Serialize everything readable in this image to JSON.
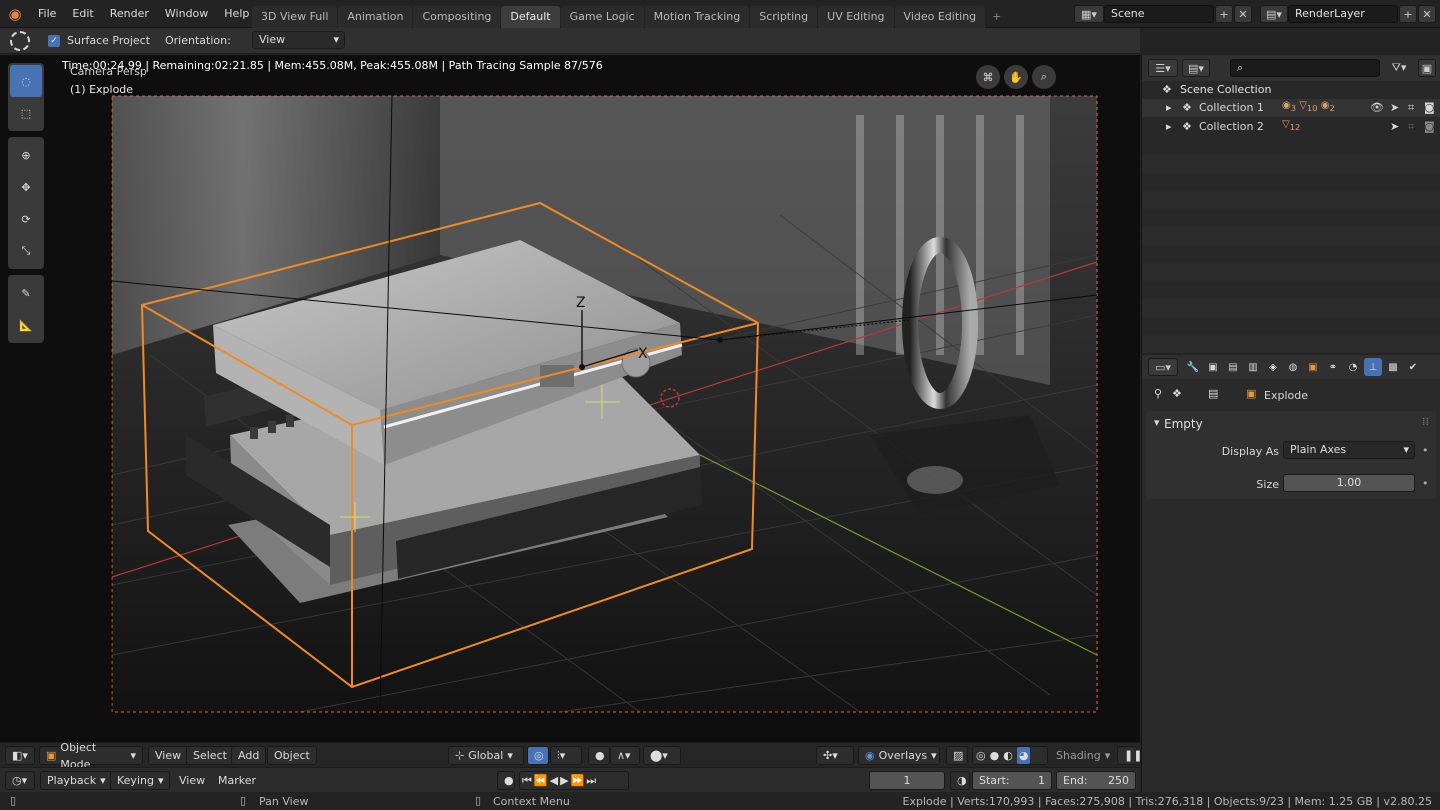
{
  "menus": [
    "File",
    "Edit",
    "Render",
    "Window",
    "Help"
  ],
  "workspace_tabs": [
    {
      "label": "3D View Full",
      "active": false
    },
    {
      "label": "Animation",
      "active": false
    },
    {
      "label": "Compositing",
      "active": false
    },
    {
      "label": "Default",
      "active": true
    },
    {
      "label": "Game Logic",
      "active": false
    },
    {
      "label": "Motion Tracking",
      "active": false
    },
    {
      "label": "Scripting",
      "active": false
    },
    {
      "label": "UV Editing",
      "active": false
    },
    {
      "label": "Video Editing",
      "active": false
    }
  ],
  "scene": {
    "name": "Scene",
    "render_layer": "RenderLayer"
  },
  "tool_settings": {
    "surface_project_label": "Surface Project",
    "surface_project_checked": true,
    "orientation_label": "Orientation:",
    "orientation_value": "View"
  },
  "viewport": {
    "render_stats": "Time:00:24.99 | Remaining:02:21.85 | Mem:455.08M, Peak:455.08M | Path Tracing Sample 87/576",
    "view_name": "Camera Persp",
    "object_label": "(1) Explode",
    "gizmo_x": "X",
    "gizmo_z": "Z"
  },
  "viewport_header": {
    "mode": "Object Mode",
    "view": "View",
    "select": "Select",
    "add": "Add",
    "object": "Object",
    "transform_orientation": "Global",
    "overlays": "Overlays",
    "shading": "Shading"
  },
  "timeline": {
    "playback": "Playback",
    "keying": "Keying",
    "view": "View",
    "marker": "Marker",
    "current_frame": "1",
    "start_label": "Start:",
    "start": "1",
    "end_label": "End:",
    "end": "250"
  },
  "statusbar": {
    "pan": "Pan View",
    "context": "Context Menu",
    "stats": "Explode | Verts:170,993 | Faces:275,908 | Tris:276,318 | Objects:9/23 | Mem: 1.25 GB | v2.80.25"
  },
  "outliner": {
    "root": "Scene Collection",
    "collections": [
      {
        "name": "Collection 1",
        "badges": [
          "3",
          "10",
          "2"
        ]
      },
      {
        "name": "Collection 2",
        "badges": [
          "12"
        ]
      }
    ]
  },
  "properties": {
    "object_name": "Explode",
    "panel_title": "Empty",
    "display_as_label": "Display As",
    "display_as_value": "Plain Axes",
    "size_label": "Size",
    "size_value": "1.00"
  },
  "colors": {
    "accent": "#4772b3",
    "selection_orange": "#f08a24",
    "header": "#232323"
  }
}
